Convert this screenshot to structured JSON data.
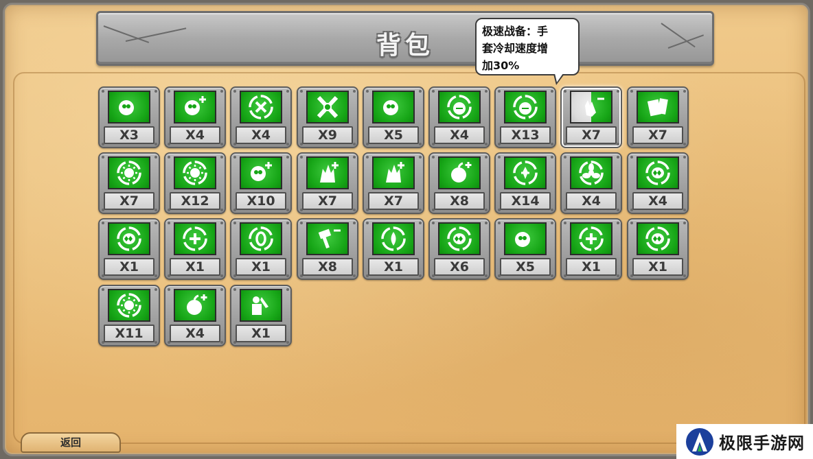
{
  "title": "背包",
  "tooltip": {
    "line1": "极速战备：手",
    "line2": "套冷却速度增",
    "line3": "加30%"
  },
  "back_label": "返回",
  "watermark": {
    "text": "极限手游网"
  },
  "colors": {
    "slot_green": "#17a617",
    "panel": "#eabd78",
    "frame": "#8d8d8d"
  },
  "items": [
    {
      "icon": "pea-shooter-icon",
      "count": "X3"
    },
    {
      "icon": "pea-plus-icon",
      "count": "X4"
    },
    {
      "icon": "crosshair-circle-icon",
      "count": "X4"
    },
    {
      "icon": "crossed-target-icon",
      "count": "X9"
    },
    {
      "icon": "pea-ring-icon",
      "count": "X5"
    },
    {
      "icon": "face-ring-icon",
      "count": "X4"
    },
    {
      "icon": "helmet-face-icon",
      "count": "X13"
    },
    {
      "icon": "glove-minus-icon",
      "count": "X7",
      "selected": true
    },
    {
      "icon": "card-icon",
      "count": "X7"
    },
    {
      "icon": "sun-minus-icon",
      "count": "X7"
    },
    {
      "icon": "sun-plus-icon",
      "count": "X12"
    },
    {
      "icon": "pea-bomb-plus-icon",
      "count": "X10"
    },
    {
      "icon": "spiky-plus-icon",
      "count": "X7"
    },
    {
      "icon": "cactus-plus-icon",
      "count": "X7"
    },
    {
      "icon": "nut-plus-icon",
      "count": "X8"
    },
    {
      "icon": "shield-plus-icon",
      "count": "X14"
    },
    {
      "icon": "fan-ring-icon",
      "count": "X4"
    },
    {
      "icon": "chomper-ring-icon",
      "count": "X4"
    },
    {
      "icon": "chomper-target-icon",
      "count": "X1"
    },
    {
      "icon": "circle-plus-icon",
      "count": "X1"
    },
    {
      "icon": "zero-ring-icon",
      "count": "X1"
    },
    {
      "icon": "hammer-minus-icon",
      "count": "X8"
    },
    {
      "icon": "drop-ring-icon",
      "count": "X1"
    },
    {
      "icon": "mouth-drop-icon",
      "count": "X6"
    },
    {
      "icon": "twin-pea-plus-icon",
      "count": "X5"
    },
    {
      "icon": "flame-plus-icon",
      "count": "X1"
    },
    {
      "icon": "chomper-ring-2-icon",
      "count": "X1"
    },
    {
      "icon": "gear-sun-icon",
      "count": "X11"
    },
    {
      "icon": "nut-plus-2-icon",
      "count": "X4"
    },
    {
      "icon": "tools-icon",
      "count": "X1"
    }
  ]
}
